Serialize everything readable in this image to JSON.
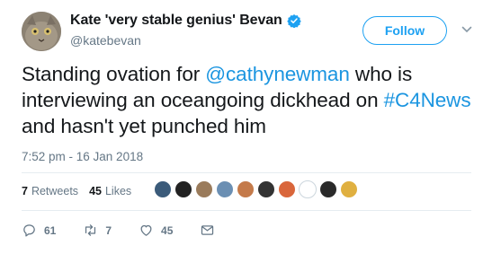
{
  "user": {
    "display_name": "Kate 'very stable genius' Bevan",
    "handle": "@katebevan"
  },
  "follow_label": "Follow",
  "tweet": {
    "text_part1": "Standing ovation for ",
    "mention": "@cathynewman",
    "text_part2": " who is interviewing an oceangoing dickhead on ",
    "hashtag": "#C4News",
    "text_part3": " and hasn't yet punched him"
  },
  "timestamp": "7:52 pm - 16 Jan 2018",
  "stats": {
    "retweets_count": "7",
    "retweets_label": "Retweets",
    "likes_count": "45",
    "likes_label": "Likes"
  },
  "likers": [
    "#3b5b7a",
    "#222222",
    "#9a7b5b",
    "#6b8fb3",
    "#c47a4a",
    "#333333",
    "#d9663b",
    "#ffffff",
    "#2a2a2a",
    "#e0b040"
  ],
  "actions": {
    "reply_count": "61",
    "retweet_count": "7",
    "like_count": "45"
  },
  "colors": {
    "accent": "#1da1f2",
    "link": "#1b95e0",
    "muted": "#657786"
  }
}
